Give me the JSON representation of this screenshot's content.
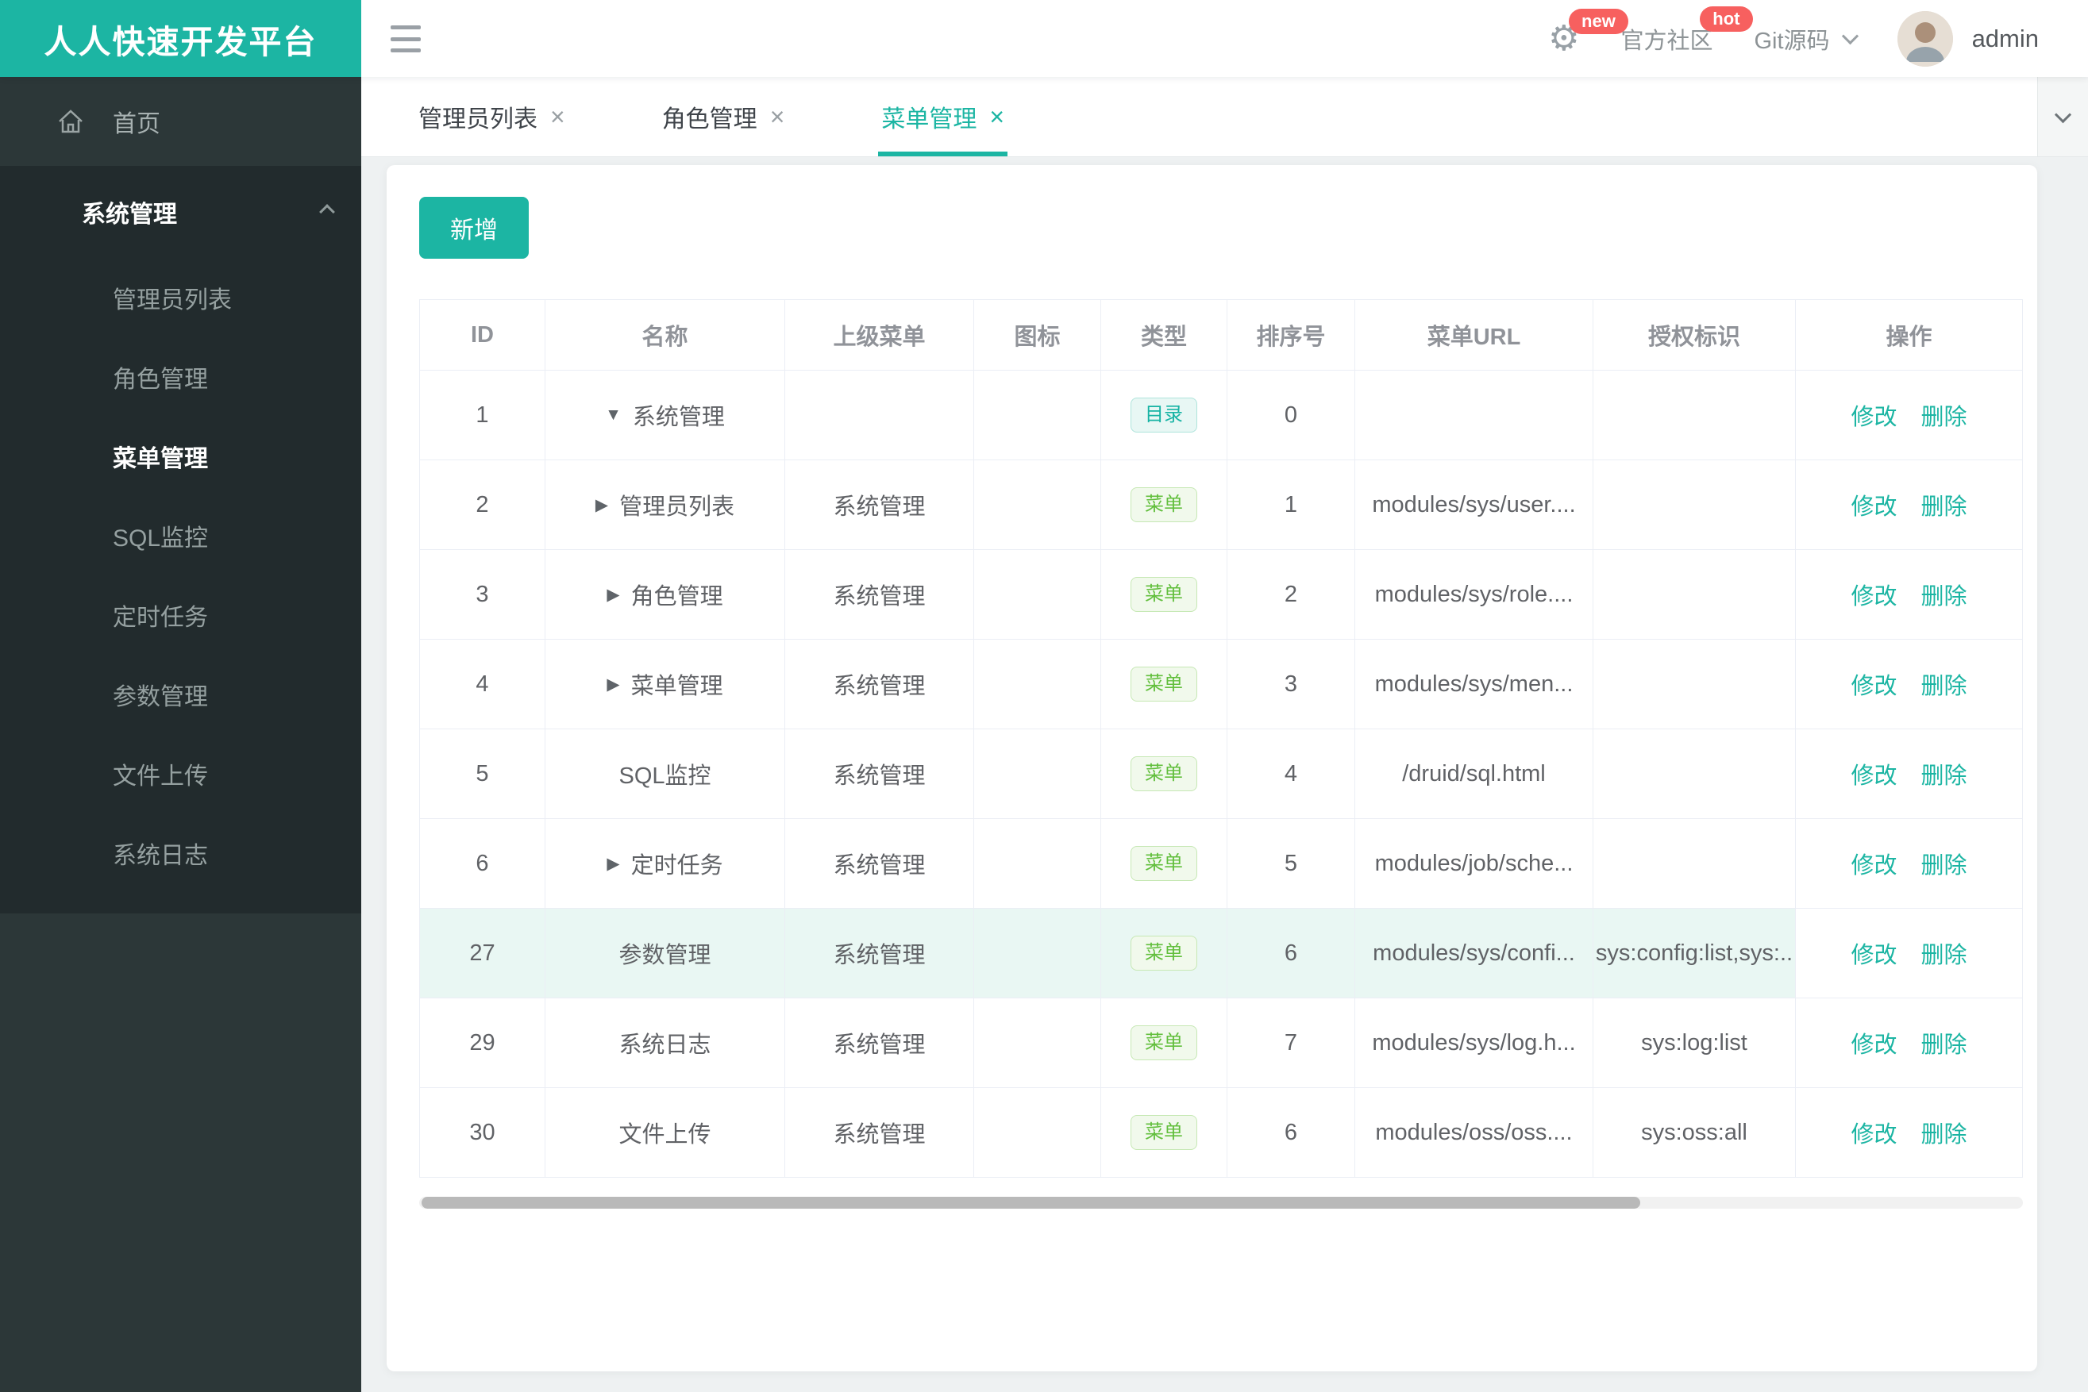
{
  "brand": {
    "title": "人人快速开发平台",
    "color": "#1cb5a3"
  },
  "header": {
    "settings_badge": "new",
    "community_label": "官方社区",
    "community_badge": "hot",
    "git_label": "Git源码",
    "user_name": "admin"
  },
  "sidebar": {
    "home_label": "首页",
    "group_label": "系统管理",
    "items": [
      "管理员列表",
      "角色管理",
      "菜单管理",
      "SQL监控",
      "定时任务",
      "参数管理",
      "文件上传",
      "系统日志"
    ],
    "active_item": "菜单管理"
  },
  "tabs": [
    {
      "label": "管理员列表",
      "active": false
    },
    {
      "label": "角色管理",
      "active": false
    },
    {
      "label": "菜单管理",
      "active": true
    }
  ],
  "toolbar": {
    "add_label": "新增"
  },
  "table": {
    "columns": [
      "ID",
      "名称",
      "上级菜单",
      "图标",
      "类型",
      "排序号",
      "菜单URL",
      "授权标识",
      "操作"
    ],
    "type_labels": {
      "dir": "目录",
      "menu": "菜单"
    },
    "op_edit": "修改",
    "op_delete": "删除",
    "rows": [
      {
        "id": "1",
        "arrow": "down",
        "name": "系统管理",
        "parent": "",
        "icon": "",
        "type": "dir",
        "order": "0",
        "url": "",
        "auth": "",
        "highlighted": false
      },
      {
        "id": "2",
        "arrow": "right",
        "name": "管理员列表",
        "parent": "系统管理",
        "icon": "",
        "type": "menu",
        "order": "1",
        "url": "modules/sys/user....",
        "auth": "",
        "highlighted": false
      },
      {
        "id": "3",
        "arrow": "right",
        "name": "角色管理",
        "parent": "系统管理",
        "icon": "",
        "type": "menu",
        "order": "2",
        "url": "modules/sys/role....",
        "auth": "",
        "highlighted": false
      },
      {
        "id": "4",
        "arrow": "right",
        "name": "菜单管理",
        "parent": "系统管理",
        "icon": "",
        "type": "menu",
        "order": "3",
        "url": "modules/sys/men...",
        "auth": "",
        "highlighted": false
      },
      {
        "id": "5",
        "arrow": null,
        "name": "SQL监控",
        "parent": "系统管理",
        "icon": "",
        "type": "menu",
        "order": "4",
        "url": "/druid/sql.html",
        "auth": "",
        "highlighted": false
      },
      {
        "id": "6",
        "arrow": "right",
        "name": "定时任务",
        "parent": "系统管理",
        "icon": "",
        "type": "menu",
        "order": "5",
        "url": "modules/job/sche...",
        "auth": "",
        "highlighted": false
      },
      {
        "id": "27",
        "arrow": null,
        "name": "参数管理",
        "parent": "系统管理",
        "icon": "",
        "type": "menu",
        "order": "6",
        "url": "modules/sys/confi...",
        "auth": "sys:config:list,sys:..",
        "highlighted": true
      },
      {
        "id": "29",
        "arrow": null,
        "name": "系统日志",
        "parent": "系统管理",
        "icon": "",
        "type": "menu",
        "order": "7",
        "url": "modules/sys/log.h...",
        "auth": "sys:log:list",
        "highlighted": false
      },
      {
        "id": "30",
        "arrow": null,
        "name": "文件上传",
        "parent": "系统管理",
        "icon": "",
        "type": "menu",
        "order": "6",
        "url": "modules/oss/oss....",
        "auth": "sys:oss:all",
        "highlighted": false
      }
    ]
  }
}
